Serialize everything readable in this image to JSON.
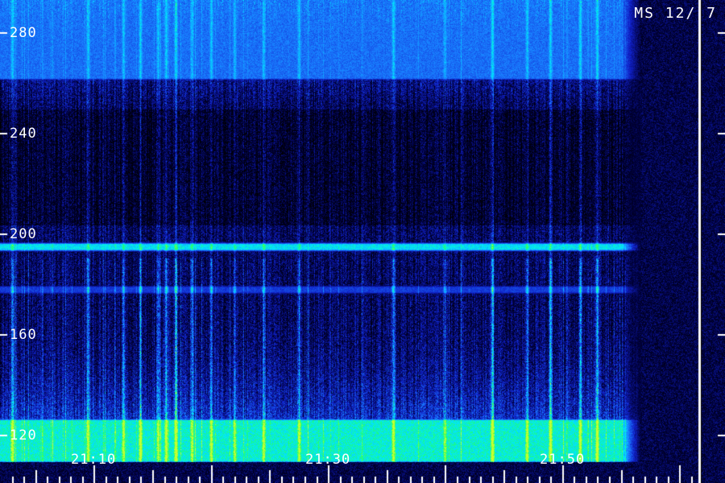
{
  "stamp": "MS 12/ 7",
  "colors": {
    "background": "#000000",
    "low": "#00003a",
    "mid_low": "#1020c8",
    "mid": "#1a7cff",
    "mid_high": "#00e8ff",
    "high": "#22ff66",
    "peak": "#c8ff30",
    "axis": "#ffffff"
  },
  "chart_data": {
    "type": "heatmap",
    "title": "",
    "xlabel": "",
    "ylabel": "",
    "y_ticks": [
      280,
      240,
      200,
      160,
      120
    ],
    "ylim": [
      110,
      293
    ],
    "x_tick_labels": [
      "21:10",
      "21:30",
      "21:50"
    ],
    "x_tick_minutes": [
      0,
      20,
      40
    ],
    "xlim_minutes": [
      -8,
      51.5
    ],
    "data_end_minutes": 45,
    "bands": [
      {
        "name": "upper band",
        "y_from": 262,
        "y_to": 293,
        "level": 0.55
      },
      {
        "name": "line",
        "y_from": 194,
        "y_to": 196,
        "level": 0.75
      },
      {
        "name": "line",
        "y_from": 177,
        "y_to": 179,
        "level": 0.45
      },
      {
        "name": "lower band",
        "y_from": 110,
        "y_to": 126,
        "level": 0.8
      }
    ],
    "bursts_minutes": [
      -7,
      -0.5,
      2.5,
      4,
      5.5,
      6.2,
      7,
      8.4,
      10,
      12,
      14.5,
      17.5,
      25.6,
      30,
      34,
      37,
      39,
      41.5,
      43
    ]
  }
}
